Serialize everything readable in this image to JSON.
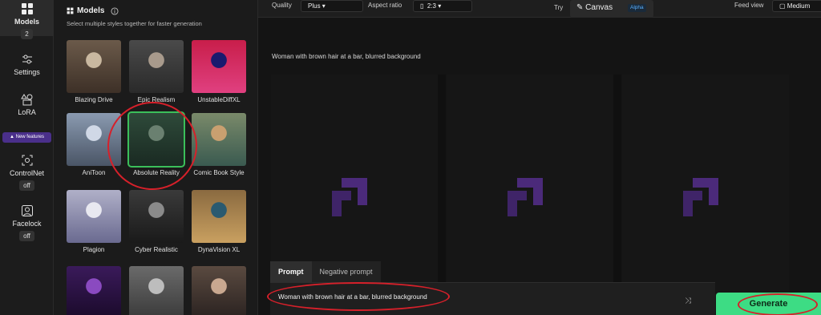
{
  "rail": {
    "models_label": "Models",
    "models_count": "2",
    "settings_label": "Settings",
    "lora_label": "LoRA",
    "new_features_label": "New features",
    "controlnet_label": "ControlNet",
    "controlnet_state": "off",
    "facelock_label": "Facelock",
    "facelock_state": "off"
  },
  "models_panel": {
    "title": "Models",
    "subtitle": "Select multiple styles together for faster generation",
    "tiles": [
      {
        "name": "Blazing Drive",
        "colors": [
          "#6b5a4a",
          "#c9b8a0",
          "#3d3027"
        ]
      },
      {
        "name": "Epic Realism",
        "colors": [
          "#4a4a4a",
          "#a89a8c",
          "#2a2a2a"
        ]
      },
      {
        "name": "UnstableDiffXL",
        "colors": [
          "#c81e4a",
          "#1a1a6e",
          "#e04080"
        ]
      },
      {
        "name": "AniToon",
        "colors": [
          "#8a9ab0",
          "#d0d8e6",
          "#4a5566"
        ]
      },
      {
        "name": "Absolute Reality",
        "colors": [
          "#2e4a3a",
          "#6a8070",
          "#1a2a22"
        ]
      },
      {
        "name": "Comic Book Style",
        "colors": [
          "#7a8a6a",
          "#c9a070",
          "#3a5a50"
        ]
      },
      {
        "name": "Plagion",
        "colors": [
          "#b0b0c8",
          "#e8e8f0",
          "#6a6a90"
        ]
      },
      {
        "name": "Cyber Realistic",
        "colors": [
          "#3a3a3a",
          "#8a8a8a",
          "#1a1a1a"
        ]
      },
      {
        "name": "DynaVision XL",
        "colors": [
          "#8a6a40",
          "#2a5a70",
          "#c9a060"
        ]
      },
      {
        "name": "",
        "colors": [
          "#3a1a5a",
          "#8a4ac0",
          "#1a0a2a"
        ]
      },
      {
        "name": "",
        "colors": [
          "#6a6a6a",
          "#bdbdbd",
          "#3a3a3a"
        ]
      },
      {
        "name": "",
        "colors": [
          "#5a4a40",
          "#c9a890",
          "#2a2220"
        ]
      }
    ]
  },
  "topbar": {
    "quality_label": "Quality",
    "quality_value": "Plus",
    "aspect_label": "Aspect ratio",
    "aspect_value": "2:3",
    "try_label": "Try",
    "canvas_label": "Canvas",
    "alpha_badge": "Alpha",
    "feed_view_label": "Feed view",
    "feed_view_value": "Medium"
  },
  "main": {
    "prompt_echo": "Woman with brown hair at a bar, blurred background",
    "tab_prompt": "Prompt",
    "tab_negative": "Negative prompt",
    "prompt_value": "Woman with brown hair at a bar, blurred background",
    "generate_label": "Generate"
  },
  "colors": {
    "accent": "#3ddc84",
    "logo": "#4b2a7a",
    "annotation": "#d6202a"
  }
}
